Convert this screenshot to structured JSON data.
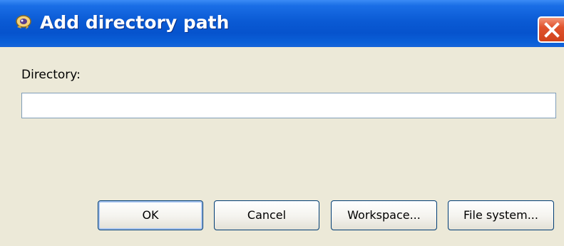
{
  "dialog": {
    "title": "Add directory path",
    "title_icon": "eclipse-dialog-icon",
    "close_icon": "close-icon"
  },
  "form": {
    "directory_label": "Directory:",
    "directory_value": "",
    "directory_placeholder": ""
  },
  "buttons": {
    "ok_label": "OK",
    "cancel_label": "Cancel",
    "workspace_label": "Workspace...",
    "file_system_label": "File system..."
  },
  "colors": {
    "titlebar": "#0653cd",
    "window_background": "#ece9d8",
    "close_button": "#e0532d",
    "button_border": "#003c74",
    "input_border": "#7f9db9"
  }
}
